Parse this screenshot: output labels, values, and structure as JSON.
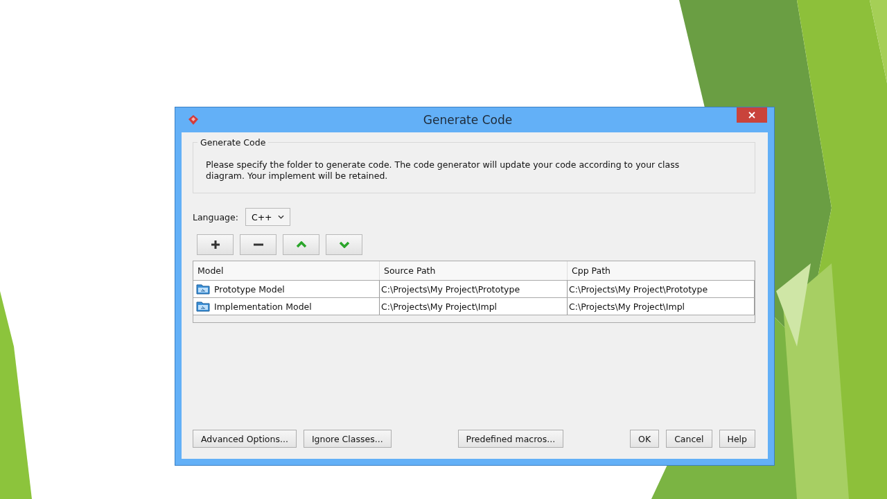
{
  "window": {
    "title": "Generate Code"
  },
  "group": {
    "title": "Generate Code",
    "description": "Please specify the folder to generate code. The code generator will update your code according to your class diagram. Your implement will be retained."
  },
  "language": {
    "label": "Language:",
    "value": "C++"
  },
  "table": {
    "columns": [
      "Model",
      "Source Path",
      "Cpp Path"
    ],
    "rows": [
      {
        "model": "Prototype Model",
        "source_path": "C:\\Projects\\My Project\\Prototype",
        "cpp_path": "C:\\Projects\\My Project\\Prototype"
      },
      {
        "model": "Implementation Model",
        "source_path": "C:\\Projects\\My Project\\Impl",
        "cpp_path": "C:\\Projects\\My Project\\Impl"
      }
    ]
  },
  "buttons": {
    "left": [
      "Advanced Options...",
      "Ignore Classes..."
    ],
    "center": [
      "Predefined macros..."
    ],
    "right": [
      "OK",
      "Cancel",
      "Help"
    ]
  }
}
